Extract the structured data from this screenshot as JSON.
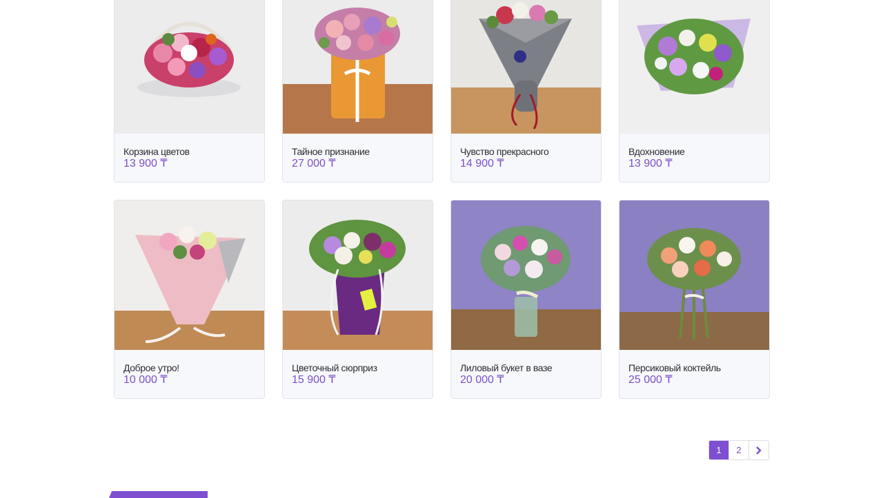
{
  "products": [
    {
      "name": "Корзина цветов",
      "price": "13 900 ₸",
      "image": "flower-basket"
    },
    {
      "name": "Тайное признание",
      "price": "27 000 ₸",
      "image": "hatbox-bouquet"
    },
    {
      "name": "Чувство прекрасного",
      "price": "14 900 ₸",
      "image": "gray-wrap-bouquet"
    },
    {
      "name": "Вдохновение",
      "price": "13 900 ₸",
      "image": "lilac-wrap-bouquet"
    },
    {
      "name": "Доброе утро!",
      "price": "10 000 ₸",
      "image": "pink-wrap-bouquet"
    },
    {
      "name": "Цветочный сюрприз",
      "price": "15 900 ₸",
      "image": "purple-bag-bouquet"
    },
    {
      "name": "Лиловый букет в вазе",
      "price": "20 000 ₸",
      "image": "vase-bouquet"
    },
    {
      "name": "Персиковый коктейль",
      "price": "25 000 ₸",
      "image": "peach-bouquet"
    }
  ],
  "pagination": {
    "pages": [
      "1",
      "2"
    ],
    "active": "1",
    "next_icon": "chevron-right-icon"
  },
  "colors": {
    "accent": "#7e4fd0",
    "price": "#7b4fc8",
    "card_bg": "#f7f8fc"
  }
}
